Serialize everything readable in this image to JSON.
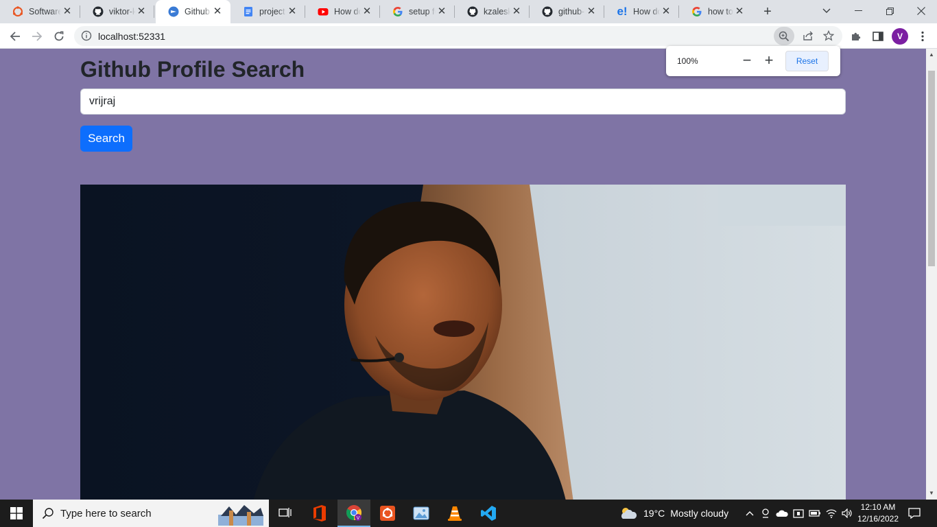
{
  "browser": {
    "tabs": [
      {
        "title": "Software",
        "icon": "ubuntu-icon"
      },
      {
        "title": "viktor-ka",
        "icon": "github-icon"
      },
      {
        "title": "Github Profile Search",
        "icon": "react-icon",
        "active": true
      },
      {
        "title": "project p",
        "icon": "docs-icon"
      },
      {
        "title": "How do",
        "icon": "youtube-icon"
      },
      {
        "title": "setup fo",
        "icon": "google-icon"
      },
      {
        "title": "kzaleska",
        "icon": "github-icon"
      },
      {
        "title": "github-u",
        "icon": "github-icon"
      },
      {
        "title": "How do",
        "icon": "educative-icon"
      },
      {
        "title": "how to",
        "icon": "google-icon"
      }
    ],
    "new_tab_label": "+",
    "close_glyph": "✕",
    "url": "localhost:52331",
    "profile_initial": "V",
    "zoom_popup": {
      "percent": "100%",
      "minus": "−",
      "plus": "+",
      "reset_label": "Reset"
    }
  },
  "page": {
    "heading": "Github Profile Search",
    "search_value": "vrijraj",
    "search_button": "Search",
    "background_color": "#7f74a5",
    "button_color": "#0d6efd"
  },
  "taskbar": {
    "search_placeholder": "Type here to search",
    "weather_temp": "19°C",
    "weather_desc": "Mostly cloudy",
    "time": "12:10 AM",
    "date": "12/16/2022",
    "apps": [
      "task-view-icon",
      "office-icon",
      "chrome-icon",
      "ubuntu-icon",
      "photos-icon",
      "vlc-icon",
      "vscode-icon"
    ]
  }
}
